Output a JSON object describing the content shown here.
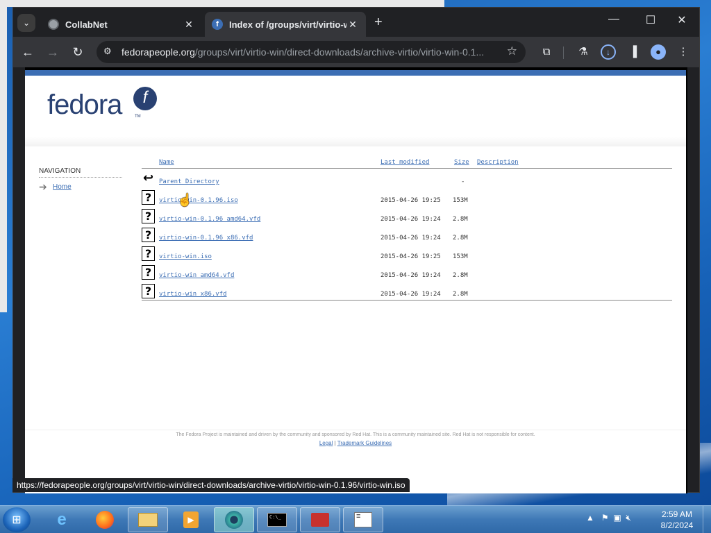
{
  "browser": {
    "tabs": [
      {
        "title": "CollabNet",
        "active": false
      },
      {
        "title": "Index of /groups/virt/virtio-wi",
        "active": true
      }
    ],
    "address": {
      "host": "fedorapeople.org",
      "path": "/groups/virt/virtio-win/direct-downloads/archive-virtio/virtio-win-0.1..."
    },
    "status_url": "https://fedorapeople.org/groups/virt/virtio-win/direct-downloads/archive-virtio/virtio-win-0.1.96/virtio-win.iso"
  },
  "page": {
    "logo_text": "fedora",
    "logo_mark": "f",
    "logo_tm": "TM",
    "nav": {
      "heading": "NAVIGATION",
      "home": "Home"
    },
    "listing": {
      "headers": {
        "name": "Name",
        "modified": "Last modified",
        "size": "Size",
        "description": "Description"
      },
      "parent": {
        "name": "Parent Directory",
        "size": "-"
      },
      "rows": [
        {
          "name": "virtio-win-0.1.96.iso",
          "modified": "2015-04-26 19:25",
          "size": "153M"
        },
        {
          "name": "virtio-win-0.1.96_amd64.vfd",
          "modified": "2015-04-26 19:24",
          "size": "2.8M"
        },
        {
          "name": "virtio-win-0.1.96_x86.vfd",
          "modified": "2015-04-26 19:24",
          "size": "2.8M"
        },
        {
          "name": "virtio-win.iso",
          "modified": "2015-04-26 19:25",
          "size": "153M"
        },
        {
          "name": "virtio-win_amd64.vfd",
          "modified": "2015-04-26 19:24",
          "size": "2.8M"
        },
        {
          "name": "virtio-win_x86.vfd",
          "modified": "2015-04-26 19:24",
          "size": "2.8M"
        }
      ]
    },
    "footer": {
      "text": "The Fedora Project is maintained and driven by the community and sponsored by Red Hat. This is a community maintained site. Red Hat is not responsible for content.",
      "legal": "Legal",
      "divider": "|",
      "trademark": "Trademark Guidelines"
    }
  },
  "taskbar": {
    "time": "2:59 AM",
    "date": "8/2/2024"
  },
  "colors": {
    "fedora_blue": "#3c6eb4",
    "fedora_dark": "#294172",
    "chrome_bg": "#202124",
    "chrome_toolbar": "#35363a"
  }
}
